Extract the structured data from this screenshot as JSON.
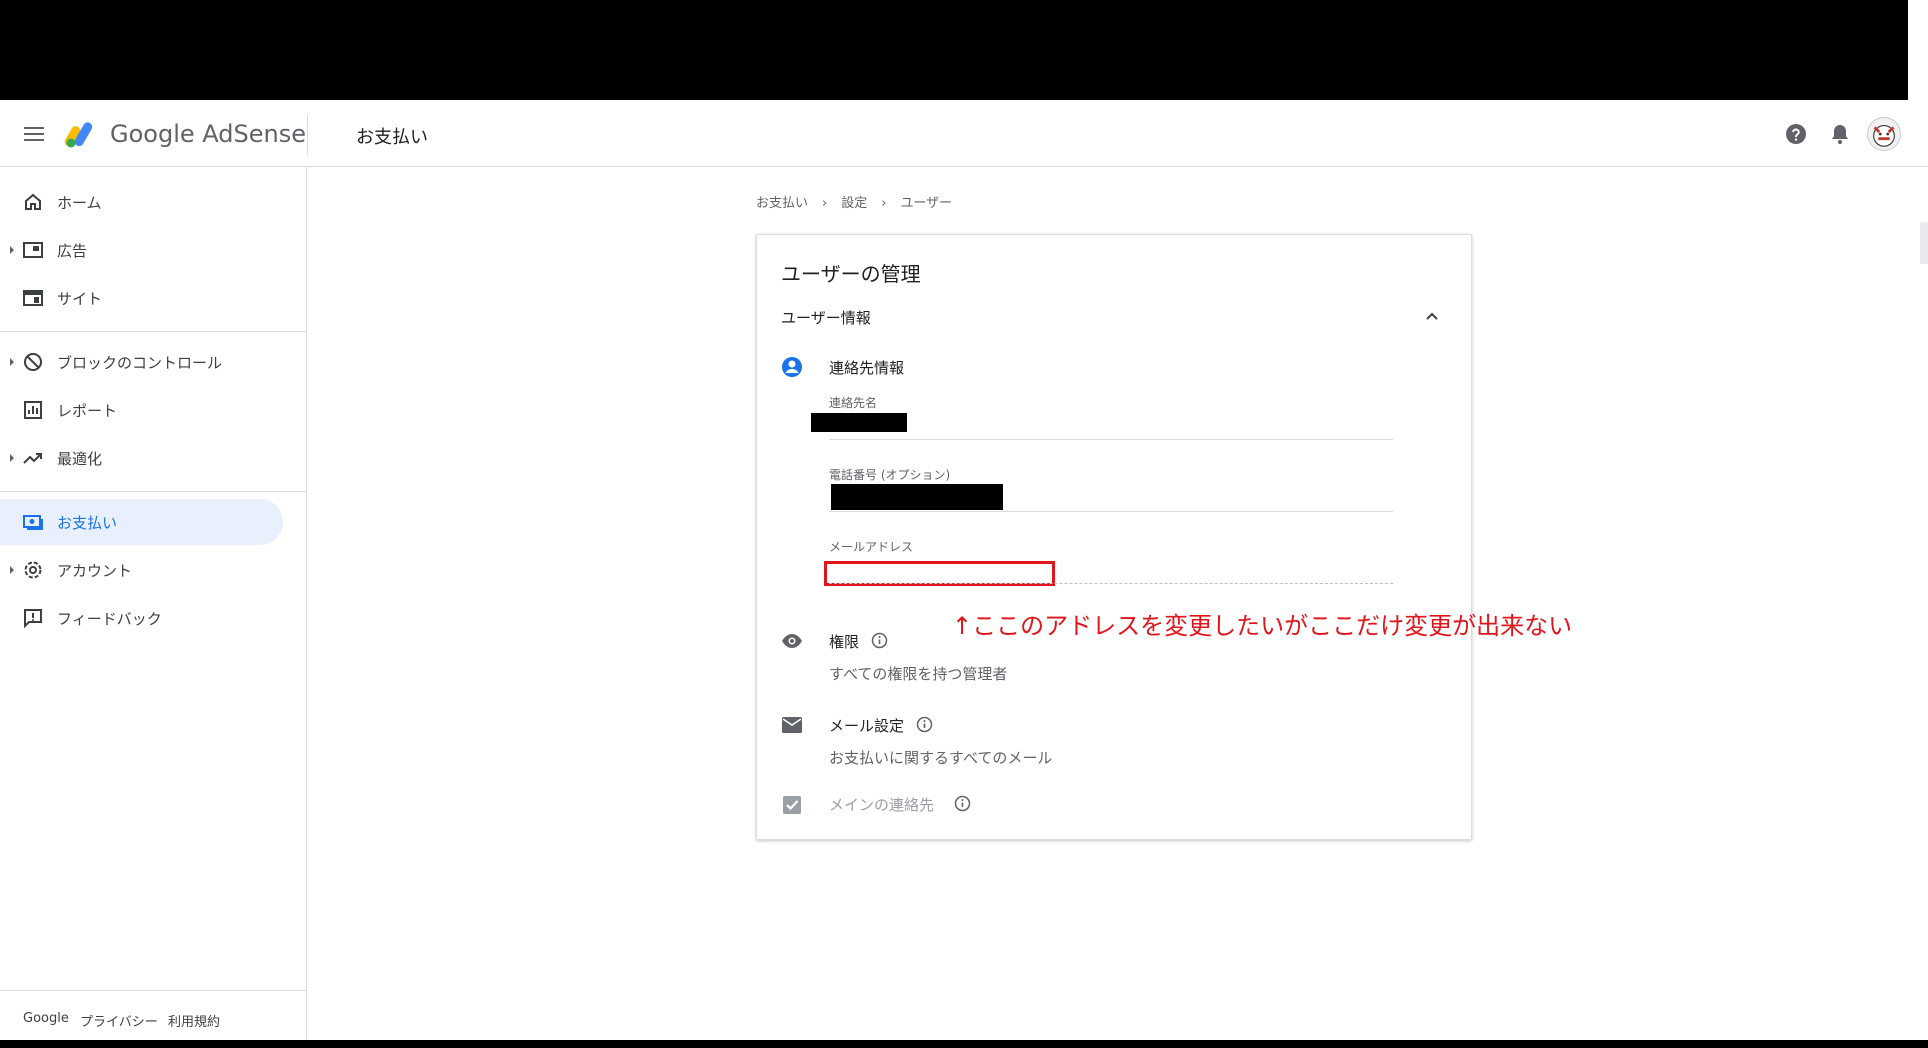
{
  "header": {
    "brand": "Google AdSense",
    "page_title": "お支払い",
    "help_icon": "help-icon",
    "notification_icon": "bell-icon",
    "avatar_icon": "avatar-icon"
  },
  "sidebar": {
    "groups": [
      [
        {
          "label": "ホーム",
          "icon": "home-icon",
          "expandable": false
        },
        {
          "label": "広告",
          "icon": "ads-icon",
          "expandable": true
        },
        {
          "label": "サイト",
          "icon": "sites-icon",
          "expandable": false
        }
      ],
      [
        {
          "label": "ブロックのコントロール",
          "icon": "block-icon",
          "expandable": true
        },
        {
          "label": "レポート",
          "icon": "reports-icon",
          "expandable": false
        },
        {
          "label": "最適化",
          "icon": "trending-icon",
          "expandable": true
        }
      ],
      [
        {
          "label": "お支払い",
          "icon": "payments-icon",
          "expandable": false,
          "active": true
        },
        {
          "label": "アカウント",
          "icon": "gear-icon",
          "expandable": true
        },
        {
          "label": "フィードバック",
          "icon": "feedback-icon",
          "expandable": false
        }
      ]
    ],
    "footer": {
      "google": "Google",
      "privacy": "プライバシー",
      "terms": "利用規約"
    }
  },
  "breadcrumb": [
    "お支払い",
    "設定",
    "ユーザー"
  ],
  "card": {
    "title": "ユーザーの管理",
    "section_title": "ユーザー情報",
    "contact": {
      "label": "連絡先情報",
      "name_label": "連絡先名",
      "phone_label": "電話番号 (オプション)",
      "email_label": "メールアドレス"
    },
    "permissions": {
      "label": "権限",
      "value": "すべての権限を持つ管理者"
    },
    "mail_settings": {
      "label": "メール設定",
      "value": "お支払いに関するすべてのメール"
    },
    "primary_contact": {
      "label": "メインの連絡先",
      "checked": true
    }
  },
  "annotation": "↑ここのアドレスを変更したいがここだけ変更が出来ない",
  "colors": {
    "accent": "#1a73e8",
    "annotation": "#e0161c",
    "active_bg": "#e8f0fe"
  }
}
